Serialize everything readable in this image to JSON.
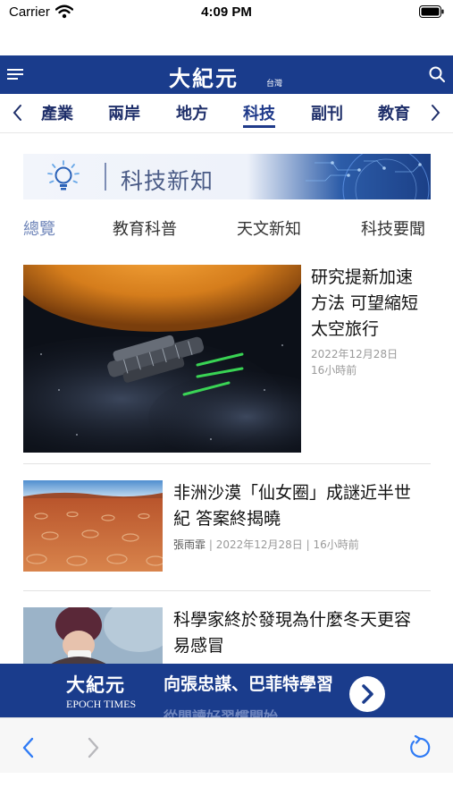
{
  "status": {
    "carrier": "Carrier",
    "time": "4:09 PM"
  },
  "header": {
    "logo": "大紀元",
    "region": "台灣",
    "bg_color": "#1a3c8c"
  },
  "tabs": {
    "items": [
      {
        "label": "產業"
      },
      {
        "label": "兩岸"
      },
      {
        "label": "地方"
      },
      {
        "label": "科技"
      },
      {
        "label": "副刊"
      },
      {
        "label": "教育"
      }
    ],
    "active": "科技"
  },
  "banner": {
    "title": "科技新知"
  },
  "subtabs": {
    "items": [
      {
        "label": "總覽"
      },
      {
        "label": "教育科普"
      },
      {
        "label": "天文新知"
      },
      {
        "label": "科技要聞"
      }
    ],
    "active": "總覽"
  },
  "articles": [
    {
      "title_lines": [
        "研究提新加速",
        "方法 可望縮短",
        "太空旅行"
      ],
      "date": "2022年12月28日",
      "ago": "16小時前"
    },
    {
      "title_lines": [
        "非洲沙漠「仙女圈」成謎近半世",
        "紀 答案終揭曉"
      ],
      "author": "張雨霏",
      "date": "2022年12月28日",
      "ago": "16小時前"
    },
    {
      "title_lines": [
        "科學家終於發現為什麼冬天更容",
        "易感冒"
      ]
    }
  ],
  "ad": {
    "logo": "大紀元",
    "logo_en": "EPOCH TIMES",
    "text": "向張忠謀、巴菲特學習",
    "subtext": "從閱讀好習慣開始"
  },
  "colors": {
    "accent": "#1a3c8c",
    "active_subtab": "#6f85b9",
    "meta_gray": "#9a9a9a"
  },
  "icons": [
    "wifi-icon",
    "battery-icon",
    "menu-icon",
    "search-icon",
    "chevron-left-icon",
    "chevron-right-icon",
    "lightbulb-icon",
    "arrow-right-icon",
    "back-icon",
    "forward-icon",
    "reload-icon"
  ]
}
